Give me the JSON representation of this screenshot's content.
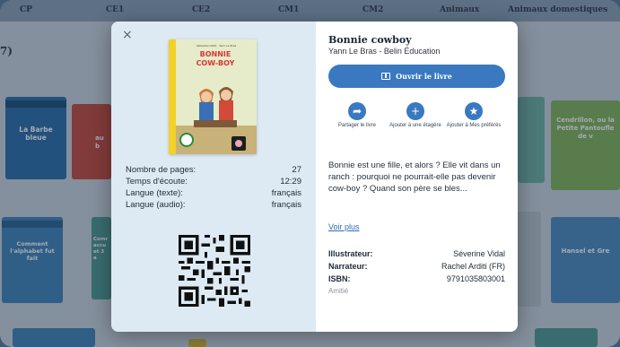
{
  "nav": {
    "items": [
      "CP",
      "CE1",
      "CE2",
      "CM1",
      "CM2",
      "Animaux",
      "Animaux domestiques"
    ]
  },
  "page": {
    "count_suffix": "7)"
  },
  "background_books": [
    {
      "title": "La Barbe bleue"
    },
    {
      "title": "au b"
    },
    {
      "title": "Cendrillon, ou la Petite Pantoufle de v"
    },
    {
      "title": "Comment l'alphabet fut fait"
    },
    {
      "title": "Comr accu et 3 a"
    },
    {
      "title": "Hansel et Gre"
    }
  ],
  "modal": {
    "close_label": "×",
    "cover": {
      "title_line1": "BONNIE",
      "title_line2": "COW-BOY",
      "author_small": "Sébastien Petit · Yann Le Bras"
    },
    "meta": [
      {
        "label": "Nombre de pages:",
        "value": "27"
      },
      {
        "label": "Temps d'écoute:",
        "value": "12:29"
      },
      {
        "label": "Langue (texte):",
        "value": "français"
      },
      {
        "label": "Langue (audio):",
        "value": "français"
      }
    ],
    "title": "Bonnie cowboy",
    "author": "Yann Le Bras - Belin Éducation",
    "open_button": "Ouvrir le livre",
    "actions": [
      {
        "icon": "share-icon",
        "glyph": "➦",
        "label": "Partager le livre"
      },
      {
        "icon": "plus-icon",
        "glyph": "+",
        "label": "Ajouter à une étagère"
      },
      {
        "icon": "star-icon",
        "glyph": "★",
        "label": "Ajouter à Mes préférés"
      }
    ],
    "description": "Bonnie est une fille, et alors ? Elle vit dans un ranch : pourquoi ne pourrait-elle pas devenir cow-boy ? Quand son père se bles...",
    "see_more": "Voir plus",
    "info": [
      {
        "label": "Illustrateur:",
        "value": "Séverine Vidal"
      },
      {
        "label": "Narrateur:",
        "value": "Rachel Arditi (FR)"
      },
      {
        "label": "ISBN:",
        "value": "9791035803001"
      }
    ],
    "tag": "Amitié"
  },
  "colors": {
    "accent": "#3a79c0",
    "modal_left_bg": "#ddeaf3",
    "nav_bg": "#8aa0b4"
  }
}
